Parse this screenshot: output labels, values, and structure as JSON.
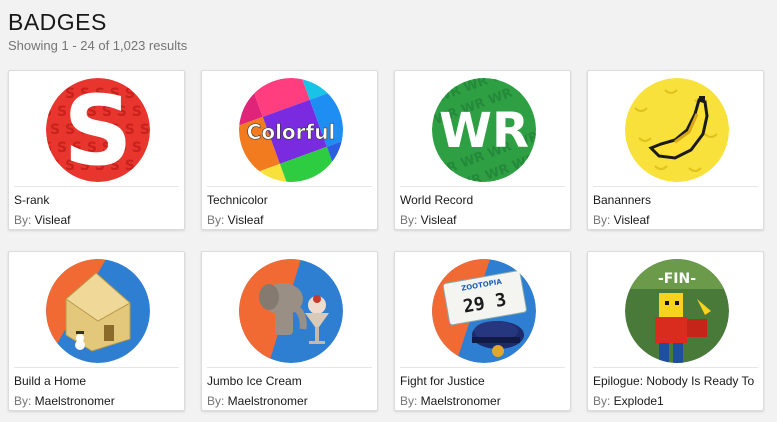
{
  "page": {
    "title": "BADGES",
    "results": "Showing 1 - 24 of 1,023 results"
  },
  "by_prefix": "By: ",
  "badges": [
    {
      "name": "S-rank",
      "creator": "Visleaf",
      "icon": "s-rank-badge-icon"
    },
    {
      "name": "Technicolor",
      "creator": "Visleaf",
      "icon": "colorful-badge-icon",
      "label": "Colorful"
    },
    {
      "name": "World Record",
      "creator": "Visleaf",
      "icon": "world-record-badge-icon",
      "label": "WR"
    },
    {
      "name": "Bananners",
      "creator": "Visleaf",
      "icon": "banana-badge-icon"
    },
    {
      "name": "Build a Home",
      "creator": "Maelstronomer",
      "icon": "house-badge-icon"
    },
    {
      "name": "Jumbo Ice Cream",
      "creator": "Maelstronomer",
      "icon": "elephant-ice-cream-badge-icon"
    },
    {
      "name": "Fight for Justice",
      "creator": "Maelstronomer",
      "icon": "police-badge-icon",
      "label_top": "ZOOTOPIA",
      "label_num": "29 3"
    },
    {
      "name": "Epilogue: Nobody Is Ready To",
      "creator": "Explode1",
      "icon": "fin-character-badge-icon",
      "label": "-FIN-"
    }
  ],
  "colors": {
    "s_red": "#e8352e",
    "wr_green": "#2ea043",
    "banana_yellow": "#f7e13a",
    "orange_half": "#f26a33",
    "blue_half": "#2e7fd1"
  }
}
